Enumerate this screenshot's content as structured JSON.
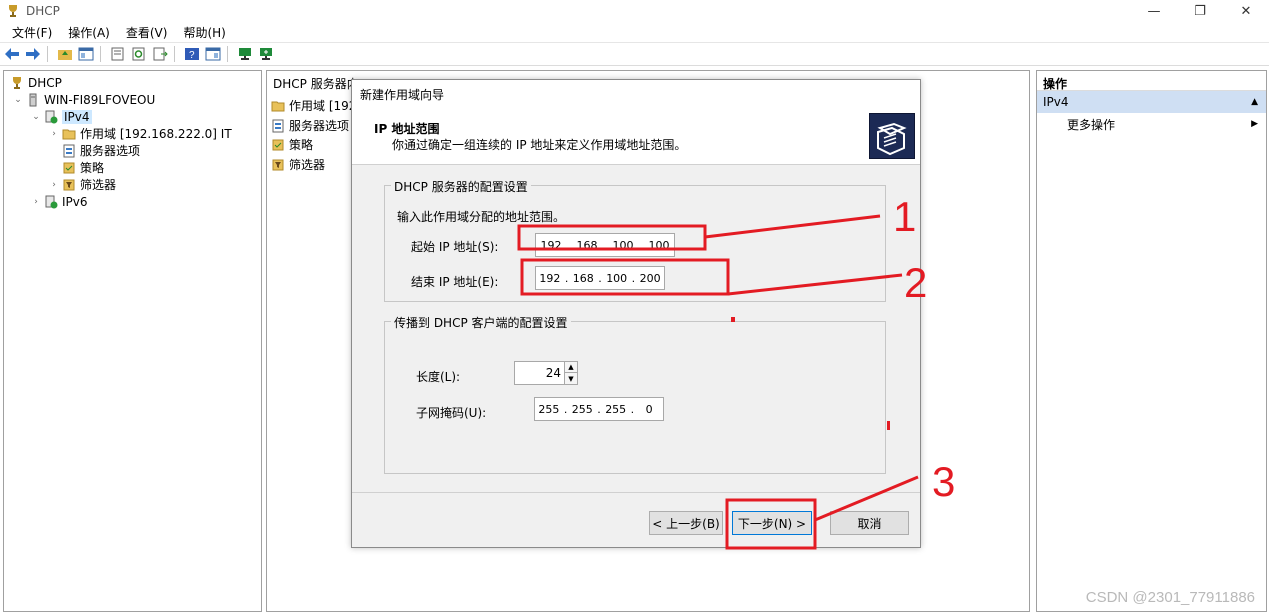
{
  "window": {
    "title": "DHCP",
    "minimize": "—",
    "restore": "❐",
    "close": "✕"
  },
  "menu": {
    "items": [
      {
        "label": "文件(F)"
      },
      {
        "label": "操作(A)"
      },
      {
        "label": "查看(V)"
      },
      {
        "label": "帮助(H)"
      }
    ]
  },
  "tree": {
    "items": [
      {
        "label": "DHCP"
      },
      {
        "label": "WIN-FI89LFOVEOU"
      },
      {
        "label": "IPv4"
      },
      {
        "label": "作用域 [192.168.222.0] IT"
      },
      {
        "label": "服务器选项"
      },
      {
        "label": "策略"
      },
      {
        "label": "筛选器"
      },
      {
        "label": "IPv6"
      }
    ]
  },
  "middle": {
    "header": "DHCP 服务器内",
    "items": [
      {
        "label": "作用域 [192."
      },
      {
        "label": "服务器选项"
      },
      {
        "label": "策略"
      },
      {
        "label": "筛选器"
      }
    ]
  },
  "actions": {
    "header": "操作",
    "section": "IPv4",
    "item": "更多操作"
  },
  "wizard": {
    "title": "新建作用域向导",
    "heading": "IP 地址范围",
    "subheading": "你通过确定一组连续的 IP 地址来定义作用域地址范围。",
    "group1": {
      "legend": "DHCP 服务器的配置设置",
      "hint": "输入此作用域分配的地址范围。",
      "start_label": "起始 IP 地址(S):",
      "start_ip": [
        "192",
        "168",
        "100",
        "100"
      ],
      "end_label": "结束 IP 地址(E):",
      "end_ip": [
        "192",
        "168",
        "100",
        "200"
      ]
    },
    "group2": {
      "legend": "传播到 DHCP 客户端的配置设置",
      "length_label": "长度(L):",
      "length_value": "24",
      "mask_label": "子网掩码(U):",
      "mask": [
        "255",
        "255",
        "255",
        "0"
      ]
    },
    "buttons": {
      "back": "< 上一步(B)",
      "next": "下一步(N) >",
      "cancel": "取消"
    }
  },
  "annotations": {
    "marks": [
      "1",
      "2",
      "3"
    ],
    "color": "#e31b23"
  },
  "watermark": "CSDN @2301_77911886"
}
